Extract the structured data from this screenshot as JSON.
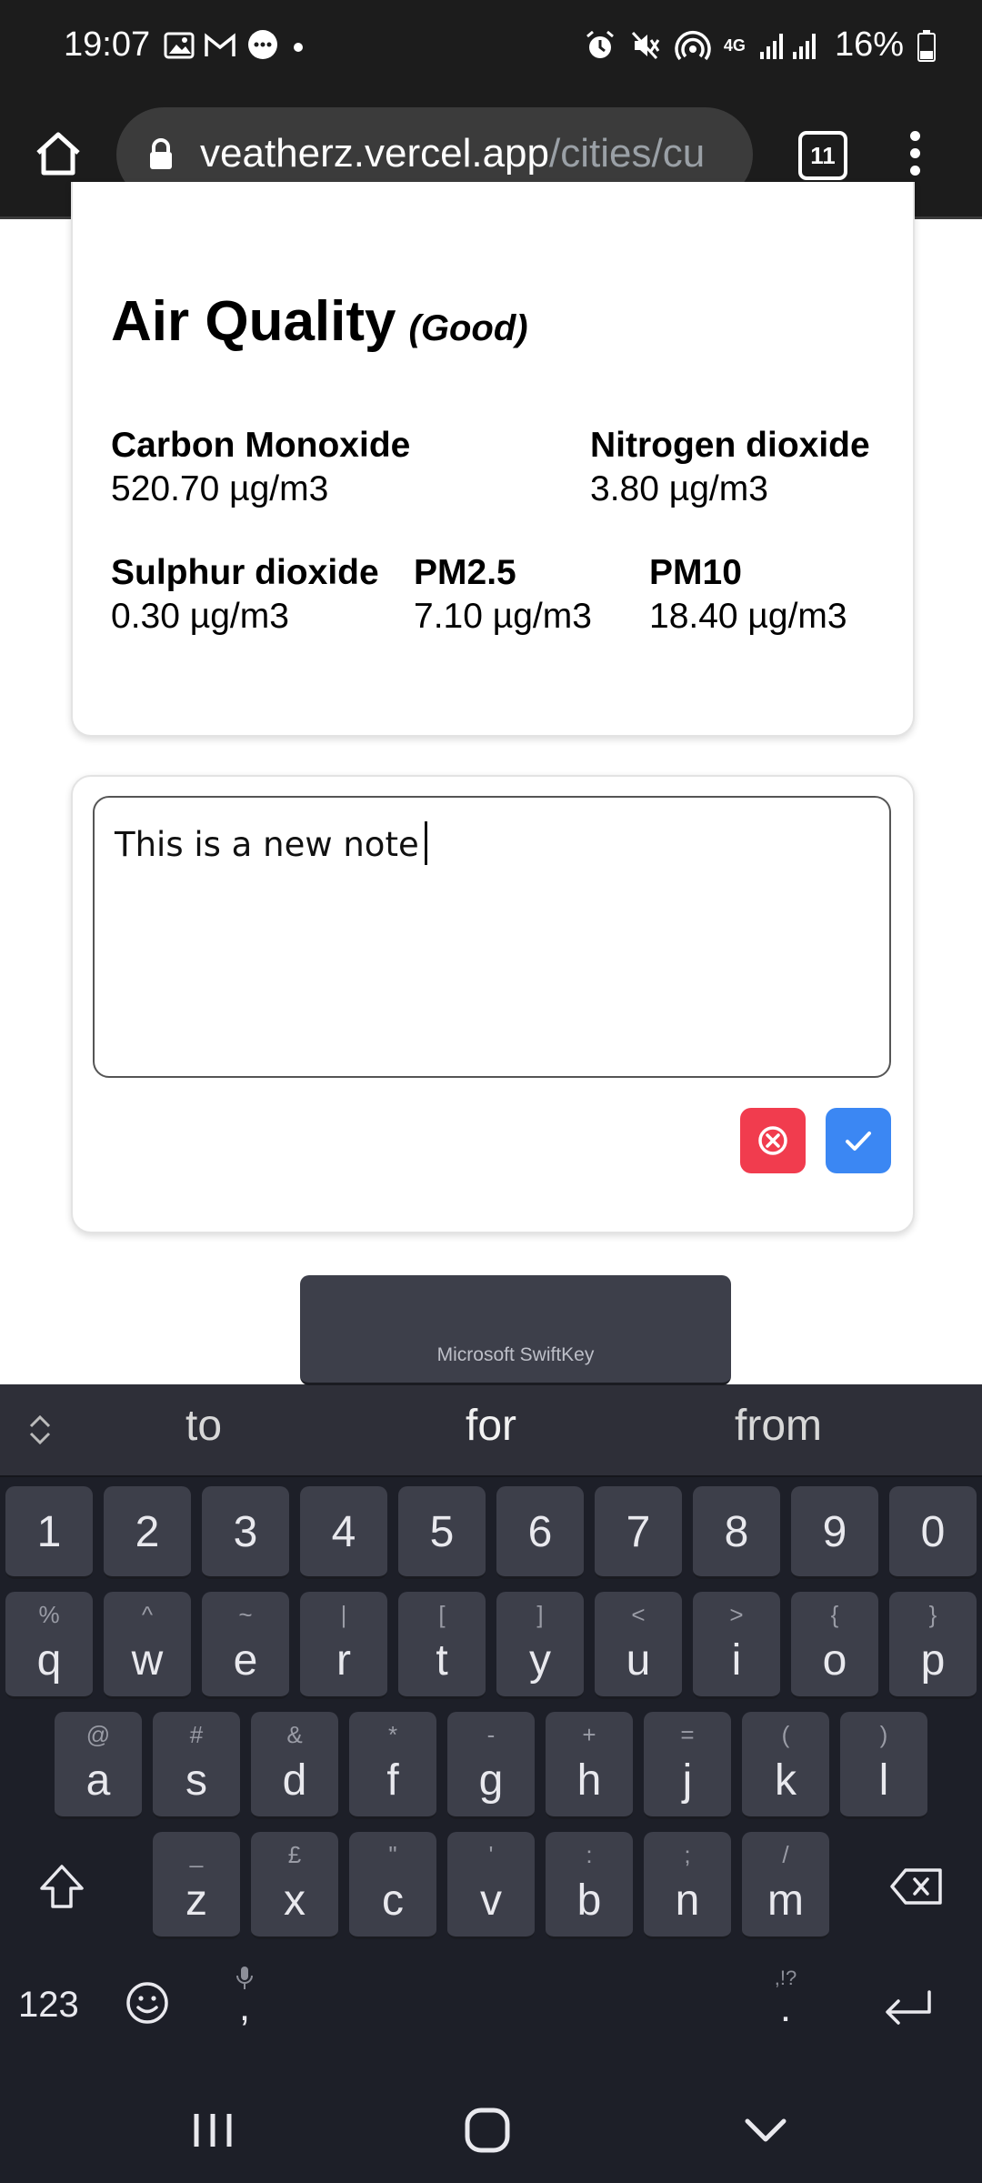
{
  "status_bar": {
    "time": "19:07",
    "network": "4G",
    "battery": "16%",
    "icons_left": [
      "image-icon",
      "gmail-icon",
      "message-icon",
      "dot-icon"
    ],
    "icons_right": [
      "alarm-icon",
      "mute-icon",
      "hotspot-icon",
      "signal-icon",
      "battery-icon"
    ]
  },
  "browser": {
    "url_host": "veatherz.vercel.app",
    "url_path": "/cities/cu",
    "tab_count": "11"
  },
  "air_quality": {
    "title": "Air Quality",
    "status": "(Good)",
    "metrics": [
      {
        "label": "Carbon Monoxide",
        "value": "520.70 µg/m3"
      },
      {
        "label": "Nitrogen dioxide",
        "value": "3.80 µg/m3"
      },
      {
        "label": "Sulphur dioxide",
        "value": "0.30 µg/m3"
      },
      {
        "label": "PM2.5",
        "value": "7.10 µg/m3"
      },
      {
        "label": "PM10",
        "value": "18.40 µg/m3"
      }
    ]
  },
  "note": {
    "text": "This is a new note"
  },
  "keyboard": {
    "suggestions": [
      "to",
      "for",
      "from"
    ],
    "numbers": [
      "1",
      "2",
      "3",
      "4",
      "5",
      "6",
      "7",
      "8",
      "9",
      "0"
    ],
    "row1": [
      {
        "k": "q",
        "a": "%"
      },
      {
        "k": "w",
        "a": "^"
      },
      {
        "k": "e",
        "a": "~"
      },
      {
        "k": "r",
        "a": "|"
      },
      {
        "k": "t",
        "a": "["
      },
      {
        "k": "y",
        "a": "]"
      },
      {
        "k": "u",
        "a": "<"
      },
      {
        "k": "i",
        "a": ">"
      },
      {
        "k": "o",
        "a": "{"
      },
      {
        "k": "p",
        "a": "}"
      }
    ],
    "row2": [
      {
        "k": "a",
        "a": "@"
      },
      {
        "k": "s",
        "a": "#"
      },
      {
        "k": "d",
        "a": "&"
      },
      {
        "k": "f",
        "a": "*"
      },
      {
        "k": "g",
        "a": "-"
      },
      {
        "k": "h",
        "a": "+"
      },
      {
        "k": "j",
        "a": "="
      },
      {
        "k": "k",
        "a": "("
      },
      {
        "k": "l",
        "a": ")"
      }
    ],
    "row3": [
      {
        "k": "z",
        "a": "_"
      },
      {
        "k": "x",
        "a": "£"
      },
      {
        "k": "c",
        "a": "\""
      },
      {
        "k": "v",
        "a": "'"
      },
      {
        "k": "b",
        "a": ":"
      },
      {
        "k": "n",
        "a": ";"
      },
      {
        "k": "m",
        "a": "/"
      }
    ],
    "symbols_label": "123",
    "comma": ",",
    "period": ".",
    "period_alt": ",!?",
    "space_label": "Microsoft SwiftKey"
  }
}
